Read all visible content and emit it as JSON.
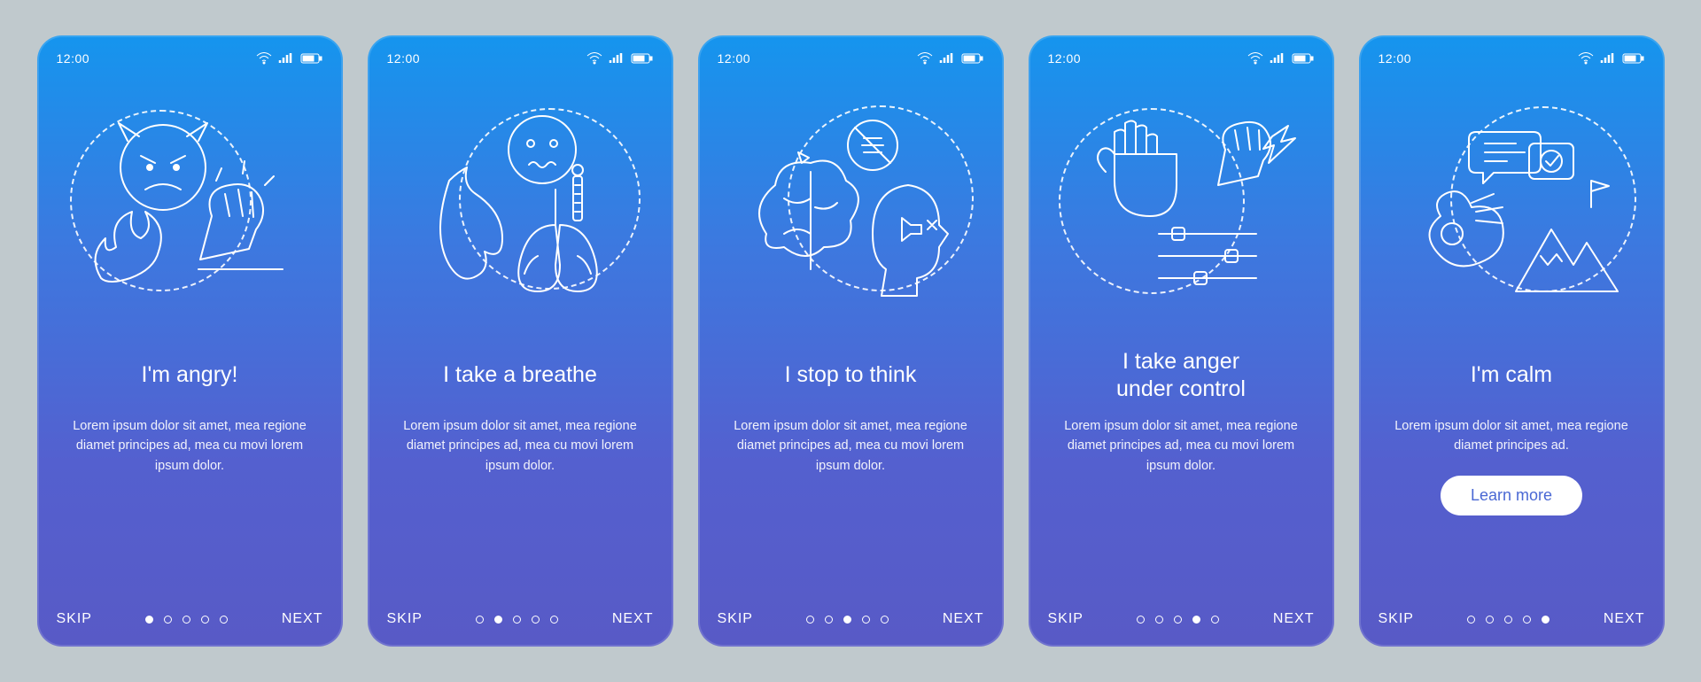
{
  "status": {
    "time": "12:00"
  },
  "nav": {
    "skip": "SKIP",
    "next": "NEXT",
    "total_steps": 5
  },
  "cta_label": "Learn more",
  "screens": [
    {
      "icon": "angry-icon",
      "title": "I'm angry!",
      "desc": "Lorem ipsum dolor sit amet, mea regione diamet principes ad, mea cu movi lorem ipsum dolor.",
      "active_dot": 0,
      "show_cta": false
    },
    {
      "icon": "breathe-icon",
      "title": "I take a breathe",
      "desc": "Lorem ipsum dolor sit amet, mea regione diamet principes ad, mea cu movi lorem ipsum dolor.",
      "active_dot": 1,
      "show_cta": false
    },
    {
      "icon": "think-icon",
      "title": "I stop to think",
      "desc": "Lorem ipsum dolor sit amet, mea regione diamet principes ad, mea cu movi lorem ipsum dolor.",
      "active_dot": 2,
      "show_cta": false
    },
    {
      "icon": "control-icon",
      "title": "I take anger\nunder control",
      "desc": "Lorem ipsum dolor sit amet, mea regione diamet principes ad, mea cu movi lorem ipsum dolor.",
      "active_dot": 3,
      "show_cta": false
    },
    {
      "icon": "calm-icon",
      "title": "I'm calm",
      "desc": "Lorem ipsum dolor sit amet, mea regione diamet principes ad.",
      "active_dot": 4,
      "show_cta": true
    }
  ]
}
